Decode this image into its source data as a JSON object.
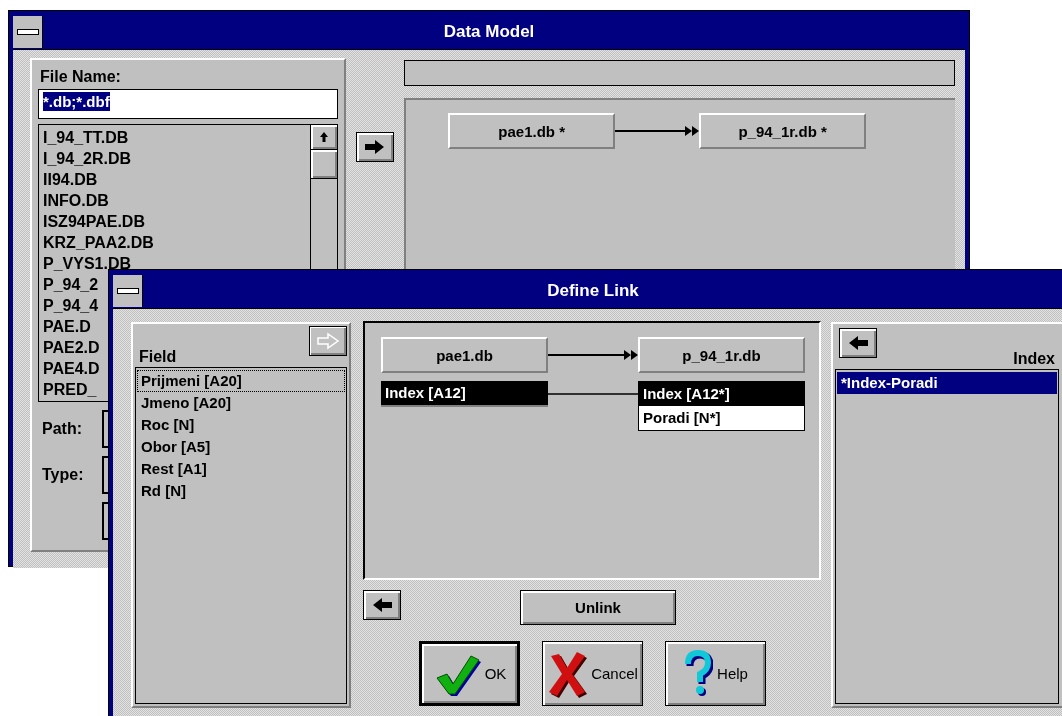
{
  "data_model": {
    "title": "Data Model",
    "file_name": {
      "label": "File Name:",
      "value": "*.db;*.dbf"
    },
    "files": [
      {
        "name": "I_94_TT.DB"
      },
      {
        "name": "I_94_2R.DB"
      },
      {
        "name": "II94.DB"
      },
      {
        "name": "INFO.DB"
      },
      {
        "name": "ISZ94PAE.DB"
      },
      {
        "name": "KRZ_PAA2.DB"
      },
      {
        "name": "P_VYS1.DB"
      },
      {
        "name": "P_94_2"
      },
      {
        "name": "P_94_4"
      },
      {
        "name": "PAE.D"
      },
      {
        "name": "PAE2.D"
      },
      {
        "name": "PAE4.D"
      },
      {
        "name": "PRED_"
      }
    ],
    "path_label": "Path:",
    "type_label": "Type:",
    "tables": [
      {
        "name": "pae1.db *"
      },
      {
        "name": "p_94_1r.db *"
      }
    ]
  },
  "define_link": {
    "title": "Define Link",
    "field_label": "Field",
    "fields": [
      {
        "name": "Prijmeni [A20]",
        "focused": true
      },
      {
        "name": "Jmeno [A20]",
        "focused": false
      },
      {
        "name": "Roc [N]",
        "focused": false
      },
      {
        "name": "Obor [A5]",
        "focused": false
      },
      {
        "name": "Rest [A1]",
        "focused": false
      },
      {
        "name": "Rd [N]",
        "focused": false
      }
    ],
    "source": {
      "name": "pae1.db",
      "fields": [
        {
          "name": "Index [A12]",
          "selected": true
        }
      ]
    },
    "target": {
      "name": "p_94_1r.db",
      "fields": [
        {
          "name": "Index [A12*]",
          "selected": true
        },
        {
          "name": "Poradi [N*]",
          "selected": false
        }
      ]
    },
    "unlink": "Unlink",
    "buttons": [
      {
        "kind": "ok",
        "label": "OK",
        "default": true
      },
      {
        "kind": "cancel",
        "label": "Cancel",
        "default": false
      },
      {
        "kind": "help",
        "label": "Help",
        "default": false
      }
    ],
    "index_label": "Index",
    "indexes": [
      {
        "name": "*Index-Poradi",
        "selected": true
      }
    ]
  }
}
